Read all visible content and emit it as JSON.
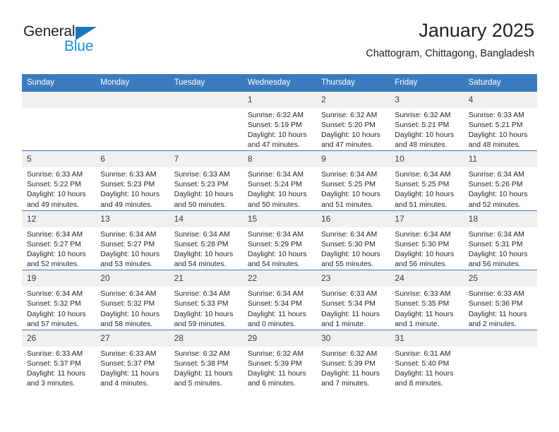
{
  "brand": {
    "name_top": "General",
    "name_bottom": "Blue",
    "accent_dark": "#1a76bc",
    "accent_light": "#1a8fe0"
  },
  "header": {
    "title": "January 2025",
    "subtitle": "Chattogram, Chittagong, Bangladesh"
  },
  "theme": {
    "header_blue": "#3a7cbe",
    "daynum_gray": "#f0f0f0",
    "text": "#231f20"
  },
  "weekdays": [
    "Sunday",
    "Monday",
    "Tuesday",
    "Wednesday",
    "Thursday",
    "Friday",
    "Saturday"
  ],
  "labels": {
    "sunrise_prefix": "Sunrise:",
    "sunset_prefix": "Sunset:",
    "daylight_prefix": "Daylight:"
  },
  "weeks": [
    [
      {
        "day": "",
        "blank": true
      },
      {
        "day": "",
        "blank": true
      },
      {
        "day": "",
        "blank": true
      },
      {
        "day": "1",
        "sunrise": "Sunrise: 6:32 AM",
        "sunset": "Sunset: 5:19 PM",
        "daylight_1": "Daylight: 10 hours",
        "daylight_2": "and 47 minutes."
      },
      {
        "day": "2",
        "sunrise": "Sunrise: 6:32 AM",
        "sunset": "Sunset: 5:20 PM",
        "daylight_1": "Daylight: 10 hours",
        "daylight_2": "and 47 minutes."
      },
      {
        "day": "3",
        "sunrise": "Sunrise: 6:32 AM",
        "sunset": "Sunset: 5:21 PM",
        "daylight_1": "Daylight: 10 hours",
        "daylight_2": "and 48 minutes."
      },
      {
        "day": "4",
        "sunrise": "Sunrise: 6:33 AM",
        "sunset": "Sunset: 5:21 PM",
        "daylight_1": "Daylight: 10 hours",
        "daylight_2": "and 48 minutes."
      }
    ],
    [
      {
        "day": "5",
        "sunrise": "Sunrise: 6:33 AM",
        "sunset": "Sunset: 5:22 PM",
        "daylight_1": "Daylight: 10 hours",
        "daylight_2": "and 49 minutes."
      },
      {
        "day": "6",
        "sunrise": "Sunrise: 6:33 AM",
        "sunset": "Sunset: 5:23 PM",
        "daylight_1": "Daylight: 10 hours",
        "daylight_2": "and 49 minutes."
      },
      {
        "day": "7",
        "sunrise": "Sunrise: 6:33 AM",
        "sunset": "Sunset: 5:23 PM",
        "daylight_1": "Daylight: 10 hours",
        "daylight_2": "and 50 minutes."
      },
      {
        "day": "8",
        "sunrise": "Sunrise: 6:34 AM",
        "sunset": "Sunset: 5:24 PM",
        "daylight_1": "Daylight: 10 hours",
        "daylight_2": "and 50 minutes."
      },
      {
        "day": "9",
        "sunrise": "Sunrise: 6:34 AM",
        "sunset": "Sunset: 5:25 PM",
        "daylight_1": "Daylight: 10 hours",
        "daylight_2": "and 51 minutes."
      },
      {
        "day": "10",
        "sunrise": "Sunrise: 6:34 AM",
        "sunset": "Sunset: 5:25 PM",
        "daylight_1": "Daylight: 10 hours",
        "daylight_2": "and 51 minutes."
      },
      {
        "day": "11",
        "sunrise": "Sunrise: 6:34 AM",
        "sunset": "Sunset: 5:26 PM",
        "daylight_1": "Daylight: 10 hours",
        "daylight_2": "and 52 minutes."
      }
    ],
    [
      {
        "day": "12",
        "sunrise": "Sunrise: 6:34 AM",
        "sunset": "Sunset: 5:27 PM",
        "daylight_1": "Daylight: 10 hours",
        "daylight_2": "and 52 minutes."
      },
      {
        "day": "13",
        "sunrise": "Sunrise: 6:34 AM",
        "sunset": "Sunset: 5:27 PM",
        "daylight_1": "Daylight: 10 hours",
        "daylight_2": "and 53 minutes."
      },
      {
        "day": "14",
        "sunrise": "Sunrise: 6:34 AM",
        "sunset": "Sunset: 5:28 PM",
        "daylight_1": "Daylight: 10 hours",
        "daylight_2": "and 54 minutes."
      },
      {
        "day": "15",
        "sunrise": "Sunrise: 6:34 AM",
        "sunset": "Sunset: 5:29 PM",
        "daylight_1": "Daylight: 10 hours",
        "daylight_2": "and 54 minutes."
      },
      {
        "day": "16",
        "sunrise": "Sunrise: 6:34 AM",
        "sunset": "Sunset: 5:30 PM",
        "daylight_1": "Daylight: 10 hours",
        "daylight_2": "and 55 minutes."
      },
      {
        "day": "17",
        "sunrise": "Sunrise: 6:34 AM",
        "sunset": "Sunset: 5:30 PM",
        "daylight_1": "Daylight: 10 hours",
        "daylight_2": "and 56 minutes."
      },
      {
        "day": "18",
        "sunrise": "Sunrise: 6:34 AM",
        "sunset": "Sunset: 5:31 PM",
        "daylight_1": "Daylight: 10 hours",
        "daylight_2": "and 56 minutes."
      }
    ],
    [
      {
        "day": "19",
        "sunrise": "Sunrise: 6:34 AM",
        "sunset": "Sunset: 5:32 PM",
        "daylight_1": "Daylight: 10 hours",
        "daylight_2": "and 57 minutes."
      },
      {
        "day": "20",
        "sunrise": "Sunrise: 6:34 AM",
        "sunset": "Sunset: 5:32 PM",
        "daylight_1": "Daylight: 10 hours",
        "daylight_2": "and 58 minutes."
      },
      {
        "day": "21",
        "sunrise": "Sunrise: 6:34 AM",
        "sunset": "Sunset: 5:33 PM",
        "daylight_1": "Daylight: 10 hours",
        "daylight_2": "and 59 minutes."
      },
      {
        "day": "22",
        "sunrise": "Sunrise: 6:34 AM",
        "sunset": "Sunset: 5:34 PM",
        "daylight_1": "Daylight: 11 hours",
        "daylight_2": "and 0 minutes."
      },
      {
        "day": "23",
        "sunrise": "Sunrise: 6:33 AM",
        "sunset": "Sunset: 5:34 PM",
        "daylight_1": "Daylight: 11 hours",
        "daylight_2": "and 1 minute."
      },
      {
        "day": "24",
        "sunrise": "Sunrise: 6:33 AM",
        "sunset": "Sunset: 5:35 PM",
        "daylight_1": "Daylight: 11 hours",
        "daylight_2": "and 1 minute."
      },
      {
        "day": "25",
        "sunrise": "Sunrise: 6:33 AM",
        "sunset": "Sunset: 5:36 PM",
        "daylight_1": "Daylight: 11 hours",
        "daylight_2": "and 2 minutes."
      }
    ],
    [
      {
        "day": "26",
        "sunrise": "Sunrise: 6:33 AM",
        "sunset": "Sunset: 5:37 PM",
        "daylight_1": "Daylight: 11 hours",
        "daylight_2": "and 3 minutes."
      },
      {
        "day": "27",
        "sunrise": "Sunrise: 6:33 AM",
        "sunset": "Sunset: 5:37 PM",
        "daylight_1": "Daylight: 11 hours",
        "daylight_2": "and 4 minutes."
      },
      {
        "day": "28",
        "sunrise": "Sunrise: 6:32 AM",
        "sunset": "Sunset: 5:38 PM",
        "daylight_1": "Daylight: 11 hours",
        "daylight_2": "and 5 minutes."
      },
      {
        "day": "29",
        "sunrise": "Sunrise: 6:32 AM",
        "sunset": "Sunset: 5:39 PM",
        "daylight_1": "Daylight: 11 hours",
        "daylight_2": "and 6 minutes."
      },
      {
        "day": "30",
        "sunrise": "Sunrise: 6:32 AM",
        "sunset": "Sunset: 5:39 PM",
        "daylight_1": "Daylight: 11 hours",
        "daylight_2": "and 7 minutes."
      },
      {
        "day": "31",
        "sunrise": "Sunrise: 6:31 AM",
        "sunset": "Sunset: 5:40 PM",
        "daylight_1": "Daylight: 11 hours",
        "daylight_2": "and 8 minutes."
      },
      {
        "day": "",
        "blank": true
      }
    ]
  ]
}
